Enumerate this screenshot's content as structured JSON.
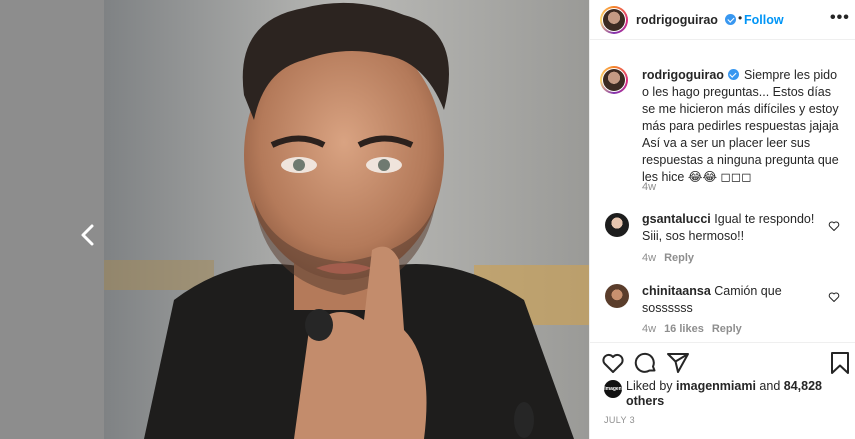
{
  "post": {
    "author": "rodrigoguirao",
    "follow_label": "Follow",
    "header_separator": "•",
    "more_label": "•••",
    "caption": "Siempre les pido o les hago preguntas... Estos días se me hicieron más difíciles y estoy más para pedirles respuestas jajaja Así va a ser un placer leer sus respuestas a ninguna pregunta que les hice 😂😂 ◻◻◻",
    "caption_age": "4w"
  },
  "comments": [
    {
      "username": "gsantalucci",
      "text": "Igual te respondo! Siii, sos hermoso!!",
      "age": "4w",
      "likes": "",
      "reply_label": "Reply"
    },
    {
      "username": "chinitaansa",
      "text": "Camión que sossssss",
      "age": "4w",
      "likes": "16 likes",
      "reply_label": "Reply"
    }
  ],
  "likes": {
    "prefix": "Liked by",
    "user": "imagenmiami",
    "connector": "and",
    "others": "84,828 others",
    "avatar_label": "imagen"
  },
  "date": "JULY 3",
  "icons": [
    "chevron-left-icon",
    "verified-badge-icon",
    "more-options-icon",
    "heart-icon",
    "comment-icon",
    "share-icon",
    "bookmark-icon"
  ]
}
